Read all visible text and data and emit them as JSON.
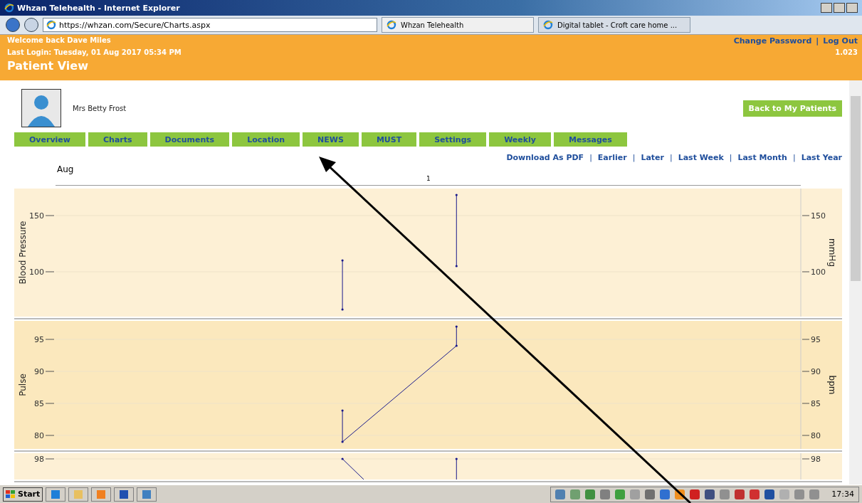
{
  "window": {
    "title": "Whzan Telehealth - Internet Explorer"
  },
  "browser": {
    "url": "https://whzan.com/Secure/Charts.aspx",
    "tabs": [
      {
        "label": "Whzan Telehealth",
        "selected": true
      },
      {
        "label": "Digital tablet - Croft care home ...",
        "selected": false
      }
    ]
  },
  "header": {
    "welcome": "Welcome back Dave Miles",
    "last_login": "Last Login: Tuesday, 01 Aug 2017 05:34 PM",
    "title": "Patient View",
    "links": [
      "Change Password",
      "Log Out"
    ],
    "separator": "|",
    "version": "1.023"
  },
  "patient": {
    "name": "Mrs Betty Frost",
    "button": "Back to My Patients"
  },
  "nav_tabs": [
    "Overview",
    "Charts",
    "Documents",
    "Location",
    "NEWS",
    "MUST",
    "Settings",
    "Weekly",
    "Messages"
  ],
  "range_links": [
    "Download As PDF",
    "Earlier",
    "Later",
    "Last Week",
    "Last Month",
    "Last Year"
  ],
  "range_separator": "|",
  "timeline": {
    "month": "Aug",
    "day": "1"
  },
  "charts": [
    {
      "kind": "blood_pressure",
      "ylabel": "Blood Pressure",
      "unit": "mmHg",
      "left_tick_labels": [
        "150",
        "100"
      ],
      "right_tick_labels": [
        "150",
        "100"
      ]
    },
    {
      "kind": "pulse",
      "ylabel": "Pulse",
      "unit": "bpm",
      "left_tick_labels": [
        "95",
        "90",
        "85",
        "80"
      ],
      "right_tick_labels": [
        "95",
        "90",
        "85",
        "80"
      ]
    },
    {
      "kind": "partial",
      "left_tick_labels": [
        "98"
      ],
      "right_tick_labels": [
        "98"
      ]
    }
  ],
  "taskbar": {
    "start": "Start",
    "clock": "17:34"
  }
}
